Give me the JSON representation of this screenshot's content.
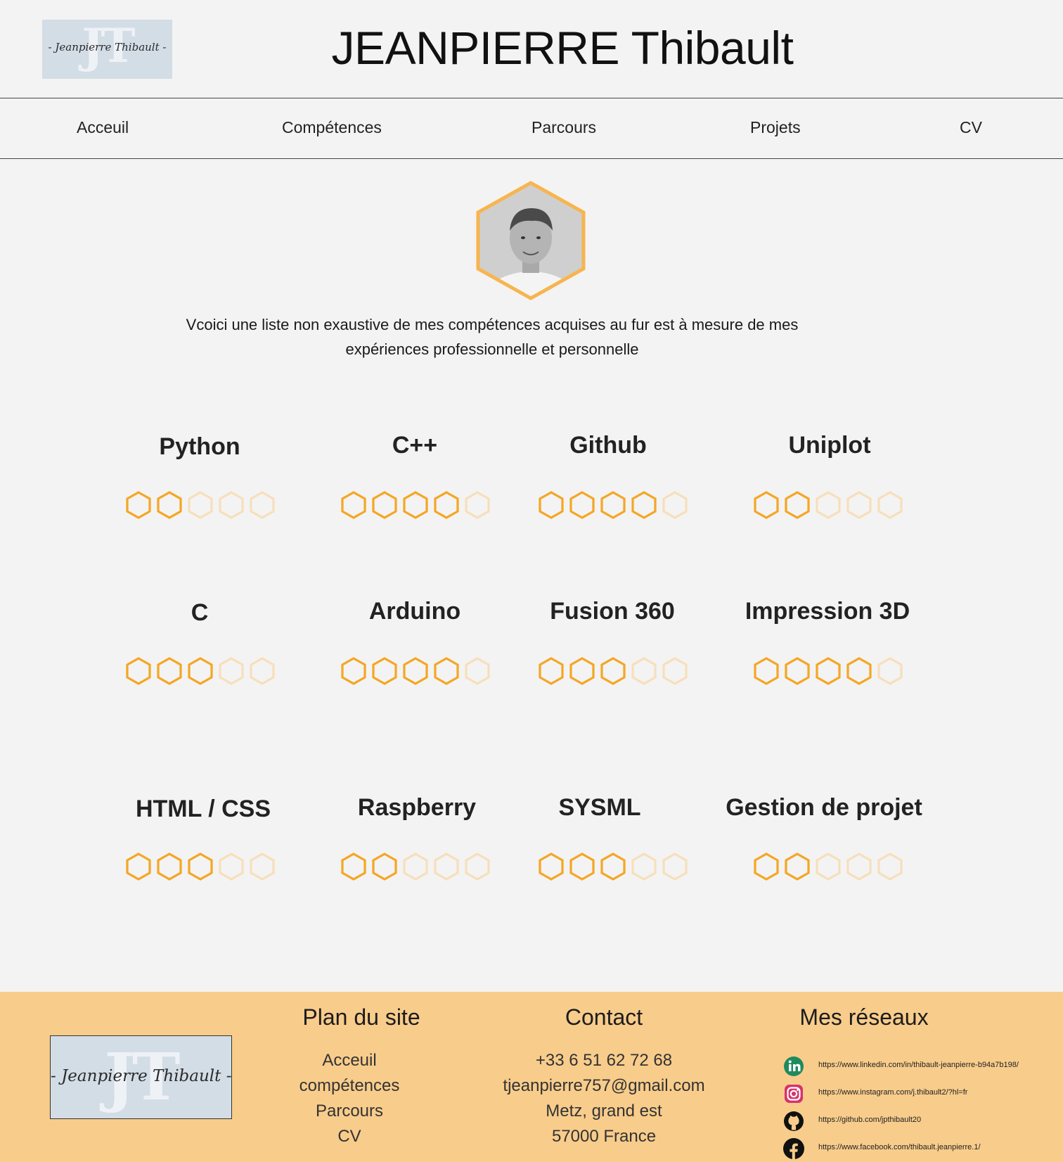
{
  "header": {
    "logo_text": "JT",
    "logo_signature": "- Jeanpierre Thibault -",
    "title": "JEANPIERRE Thibault"
  },
  "nav": {
    "items": [
      "Acceuil",
      "Compétences",
      "Parcours",
      "Projets",
      "CV"
    ]
  },
  "profile": {
    "avatar_icon": "user-avatar",
    "intro_line1": "Vcoici une liste non exaustive de mes compétences acquises au fur est  à mesure de mes",
    "intro_line2": "expériences professionnelle et personnelle"
  },
  "colors": {
    "accent": "#f5a623",
    "accent_faded": "#f7dfbb",
    "footer_bg": "#f8cc8b",
    "page_bg": "#f3f3f3"
  },
  "skills": [
    {
      "name": "Python",
      "level": 2,
      "max": 5
    },
    {
      "name": "C++",
      "level": 4,
      "max": 5
    },
    {
      "name": "Github",
      "level": 4,
      "max": 5
    },
    {
      "name": "Uniplot",
      "level": 2,
      "max": 5
    },
    {
      "name": "C",
      "level": 3,
      "max": 5
    },
    {
      "name": "Arduino",
      "level": 4,
      "max": 5
    },
    {
      "name": "Fusion 360",
      "level": 3,
      "max": 5
    },
    {
      "name": "Impression 3D",
      "level": 4,
      "max": 5
    },
    {
      "name": "HTML / CSS",
      "level": 3,
      "max": 5
    },
    {
      "name": "Raspberry",
      "level": 2,
      "max": 5
    },
    {
      "name": "SYSML",
      "level": 3,
      "max": 5
    },
    {
      "name": "Gestion de projet",
      "level": 2,
      "max": 5
    }
  ],
  "footer": {
    "sitemap": {
      "title": "Plan du site",
      "links": [
        "Acceuil",
        "compétences",
        "Parcours",
        "CV"
      ]
    },
    "contact": {
      "title": "Contact",
      "phone": "+33 6 51 62 72 68",
      "email": "tjeanpierre757@gmail.com",
      "city": "Metz, grand est",
      "postal": "57000 France"
    },
    "networks": {
      "title": "Mes réseaux",
      "items": [
        {
          "icon": "linkedin-icon",
          "url": "https://www.linkedin.com/in/thibault-jeanpierre-b94a7b198/"
        },
        {
          "icon": "instagram-icon",
          "url": "https://www.instagram.com/j.thibault2/?hl=fr"
        },
        {
          "icon": "github-icon",
          "url": "https://github.com/jpthibault20"
        },
        {
          "icon": "facebook-icon",
          "url": "https://www.facebook.com/thibault.jeanpierre.1/"
        }
      ]
    }
  }
}
